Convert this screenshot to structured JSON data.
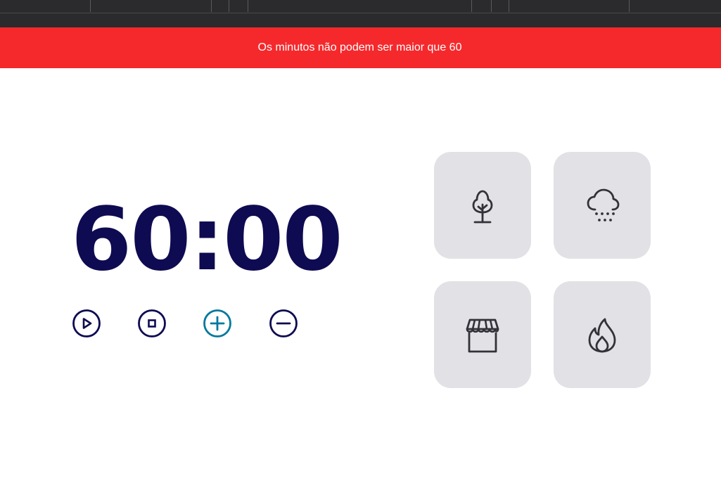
{
  "alert": {
    "message": "Os minutos não podem ser maior que 60",
    "color": "#f5292c"
  },
  "timer": {
    "minutes": "60",
    "separator": ":",
    "seconds": "00",
    "color": "#0e0b52"
  },
  "controls": [
    {
      "name": "play-button",
      "icon": "play-icon"
    },
    {
      "name": "stop-button",
      "icon": "stop-icon"
    },
    {
      "name": "increase-button",
      "icon": "plus-icon",
      "active": true
    },
    {
      "name": "decrease-button",
      "icon": "minus-icon"
    }
  ],
  "sounds": [
    {
      "name": "forest-sound-card",
      "icon": "tree-icon"
    },
    {
      "name": "rain-sound-card",
      "icon": "cloud-rain-icon"
    },
    {
      "name": "coffee-shop-sound-card",
      "icon": "storefront-icon"
    },
    {
      "name": "fireplace-sound-card",
      "icon": "flame-icon"
    }
  ],
  "colors": {
    "accent": "#02799d",
    "card_background": "#e1e1e6",
    "icon": "#323238",
    "topbar": "#2b2b2d"
  }
}
